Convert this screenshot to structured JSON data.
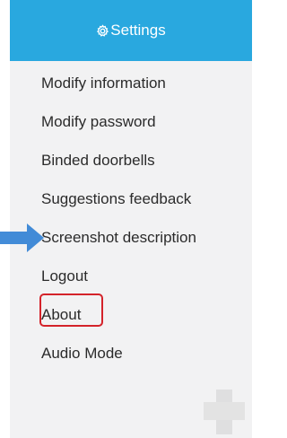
{
  "header": {
    "title": "Settings",
    "icon": "gear-icon",
    "background": "#29a8df"
  },
  "menu": {
    "items": [
      {
        "label": "Modify information"
      },
      {
        "label": "Modify password"
      },
      {
        "label": "Binded doorbells"
      },
      {
        "label": "Suggestions feedback"
      },
      {
        "label": "Screenshot description"
      },
      {
        "label": "Logout"
      },
      {
        "label": "About"
      },
      {
        "label": "Audio Mode"
      }
    ]
  },
  "annotations": {
    "arrow_color": "#2f7fd4",
    "highlight_color": "#d4232a",
    "highlighted_item": "About"
  }
}
